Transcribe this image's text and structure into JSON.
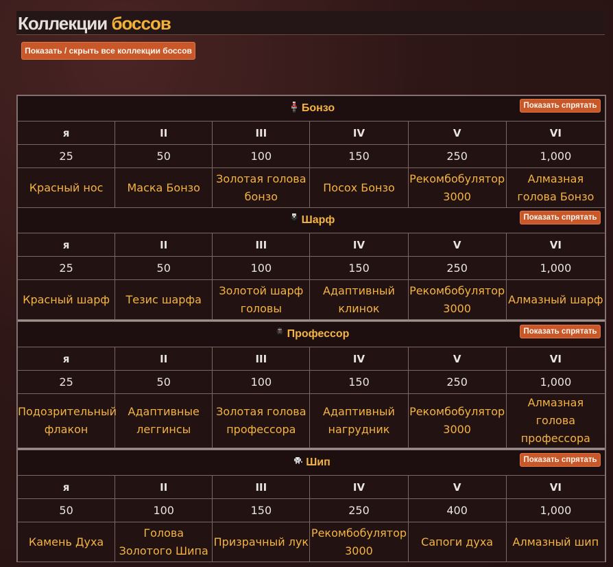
{
  "title": {
    "part1": "Коллекции",
    "part2": "боссов"
  },
  "toggle_all_label": "Показать / скрыть все коллекции боссов",
  "showhide_label": "Показать спрятать",
  "tiers": [
    "я",
    "II",
    "III",
    "IV",
    "V",
    "VI"
  ],
  "bosses": [
    {
      "name": "Бонзо",
      "icon": "bonzo-icon",
      "amounts": [
        "25",
        "50",
        "100",
        "150",
        "250",
        "1,000"
      ],
      "rewards": [
        "Красный нос",
        "Маска Бонзо",
        "Золотая голова бонзо",
        "Посох Бонзо",
        "Рекомбобулятор 3000",
        "Алмазная голова Бонзо"
      ]
    },
    {
      "name": "Шарф",
      "icon": "scarf-icon",
      "amounts": [
        "25",
        "50",
        "100",
        "150",
        "250",
        "1,000"
      ],
      "rewards": [
        "Красный шарф",
        "Тезис шарфа",
        "Золотой шарф головы",
        "Адаптивный клинок",
        "Рекомбобулятор 3000",
        "Алмазный шарф"
      ]
    },
    {
      "name": "Профессор",
      "icon": "professor-icon",
      "amounts": [
        "25",
        "50",
        "100",
        "150",
        "250",
        "1,000"
      ],
      "rewards": [
        "Подозрительный флакон",
        "Адаптивные леггинсы",
        "Золотая голова профессора",
        "Адаптивный нагрудник",
        "Рекомбобулятор 3000",
        "Алмазная голова профессора"
      ]
    },
    {
      "name": "Шип",
      "icon": "thorn-icon",
      "amounts": [
        "50",
        "100",
        "150",
        "250",
        "400",
        "1,000"
      ],
      "rewards": [
        "Камень Духа",
        "Голова Золотого Шипа",
        "Призрачный лук",
        "Рекомбобулятор 3000",
        "Сапоги духа",
        "Алмазный шип"
      ]
    }
  ]
}
